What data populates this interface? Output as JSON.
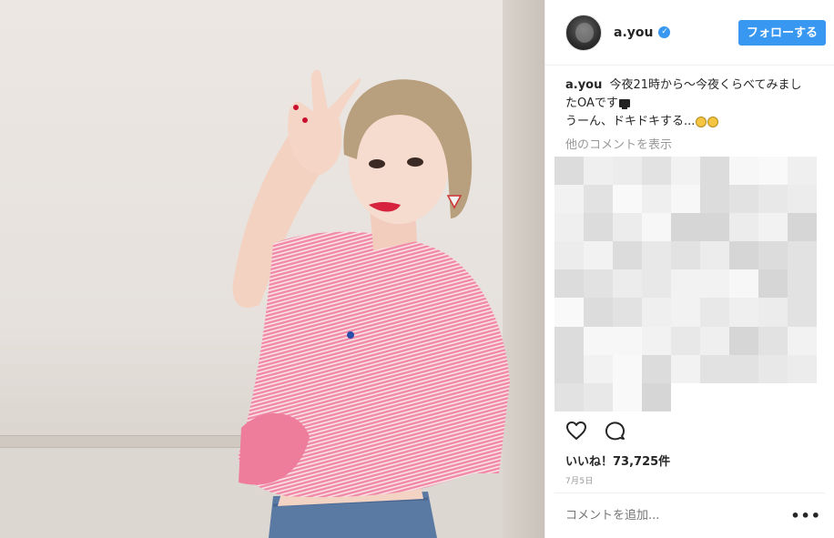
{
  "header": {
    "username": "a.you",
    "verified_mark": "✓",
    "follow_label": "フォローする"
  },
  "caption": {
    "username": "a.you",
    "line1": "今夜21時から〜今夜くらべてみまし",
    "line2": "たOAです",
    "line3": "うーん、ドキドキする..."
  },
  "comments": {
    "view_all_label": "他のコメントを表示"
  },
  "actions": {
    "like_icon": "heart-icon",
    "comment_icon": "comment-icon"
  },
  "likes": {
    "label": "いいね！73,725件"
  },
  "date": {
    "label": "7月5日"
  },
  "comment_bar": {
    "placeholder": "コメントを追加...",
    "more_label": "•••"
  },
  "colors": {
    "accent": "#3897f0",
    "text": "#262626",
    "muted": "#999999",
    "border": "#efefef"
  }
}
